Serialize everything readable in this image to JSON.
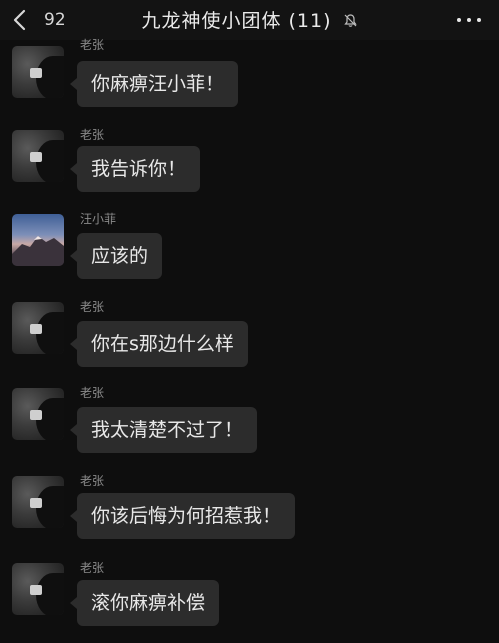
{
  "header": {
    "back_count": "92",
    "title": "九龙神使小团体 (11)",
    "mute_icon": "bell-muted-icon",
    "more_icon": "more-dots-icon"
  },
  "messages": [
    {
      "sender": "老张",
      "text": "你麻痹汪小菲！",
      "avatar": "silhouette"
    },
    {
      "sender": "老张",
      "text": "我告诉你！",
      "avatar": "silhouette"
    },
    {
      "sender": "汪小菲",
      "text": "应该的",
      "avatar": "mountain"
    },
    {
      "sender": "老张",
      "text": "你在s那边什么样",
      "avatar": "silhouette"
    },
    {
      "sender": "老张",
      "text": "我太清楚不过了！",
      "avatar": "silhouette"
    },
    {
      "sender": "老张",
      "text": "你该后悔为何招惹我！",
      "avatar": "silhouette"
    },
    {
      "sender": "老张",
      "text": "滚你麻痹补偿",
      "avatar": "silhouette"
    }
  ],
  "colors": {
    "background": "#0e0e0e",
    "bubble": "#2c2c2c",
    "name_text": "#8a8a8a"
  }
}
